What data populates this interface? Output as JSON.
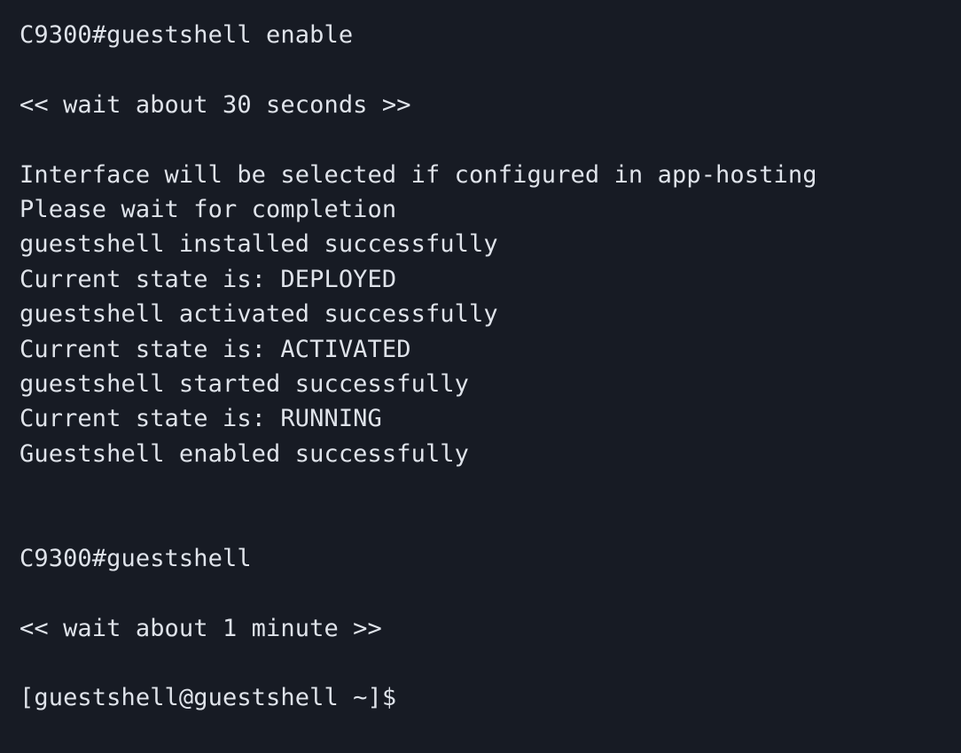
{
  "terminal": {
    "lines": [
      "C9300#guestshell enable",
      "",
      "<< wait about 30 seconds >>",
      "",
      "Interface will be selected if configured in app-hosting",
      "Please wait for completion",
      "guestshell installed successfully",
      "Current state is: DEPLOYED",
      "guestshell activated successfully",
      "Current state is: ACTIVATED",
      "guestshell started successfully",
      "Current state is: RUNNING",
      "Guestshell enabled successfully",
      "",
      "",
      "C9300#guestshell",
      "",
      "<< wait about 1 minute >>",
      "",
      "[guestshell@guestshell ~]$"
    ]
  }
}
